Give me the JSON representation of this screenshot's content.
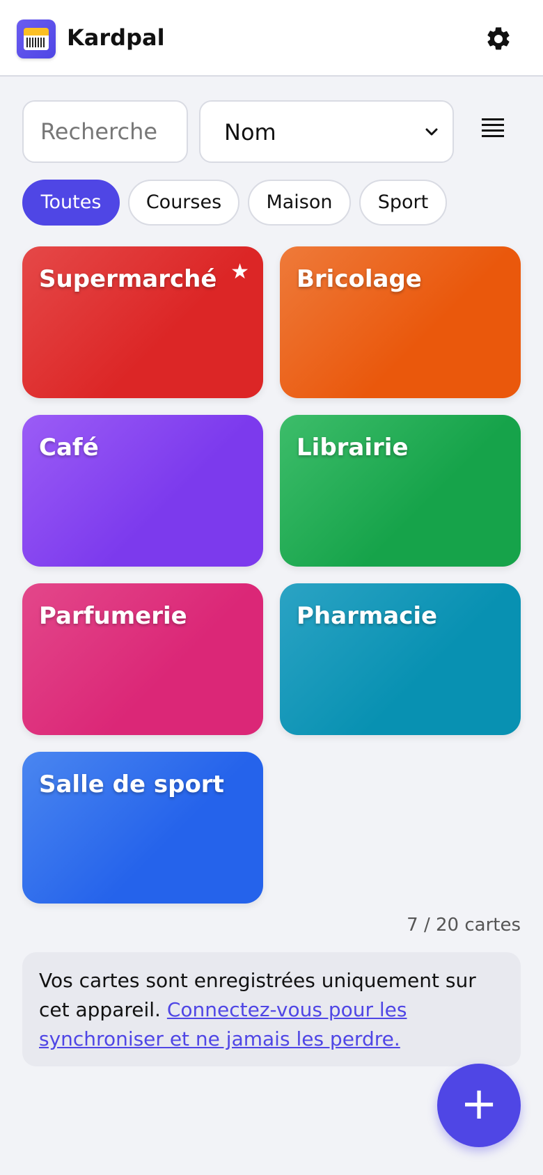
{
  "header": {
    "title": "Kardpal",
    "logo_icon": "card-logo-icon",
    "settings_icon": "gear-icon"
  },
  "toolbar": {
    "search_placeholder": "Recherche",
    "sort_value": "Nom",
    "view_toggle_icon": "list-view-icon"
  },
  "filters": [
    {
      "label": "Toutes",
      "active": true
    },
    {
      "label": "Courses",
      "active": false
    },
    {
      "label": "Maison",
      "active": false
    },
    {
      "label": "Sport",
      "active": false
    }
  ],
  "cards": [
    {
      "name": "Supermarché",
      "favorite": true,
      "color_from": "#e54848",
      "color_to": "#dc2626"
    },
    {
      "name": "Bricolage",
      "favorite": false,
      "color_from": "#ee7a3a",
      "color_to": "#ea580c"
    },
    {
      "name": "Café",
      "favorite": false,
      "color_from": "#9b5cf6",
      "color_to": "#7c3aed"
    },
    {
      "name": "Librairie",
      "favorite": false,
      "color_from": "#3dbd6a",
      "color_to": "#16a34a"
    },
    {
      "name": "Parfumerie",
      "favorite": false,
      "color_from": "#e3478a",
      "color_to": "#db2777"
    },
    {
      "name": "Pharmacie",
      "favorite": false,
      "color_from": "#2ba3c4",
      "color_to": "#0891b2"
    },
    {
      "name": "Salle de sport",
      "favorite": false,
      "color_from": "#4a86f0",
      "color_to": "#2563eb"
    }
  ],
  "count_text": "7 / 20 cartes",
  "notice": {
    "text": "Vos cartes sont enregistrées uniquement sur cet appareil. ",
    "link": "Connectez-vous pour les synchroniser et ne jamais les perdre."
  },
  "fab": {
    "label": "+",
    "icon": "plus-icon"
  },
  "colors": {
    "accent": "#4f46e5",
    "background": "#f2f3f7"
  }
}
